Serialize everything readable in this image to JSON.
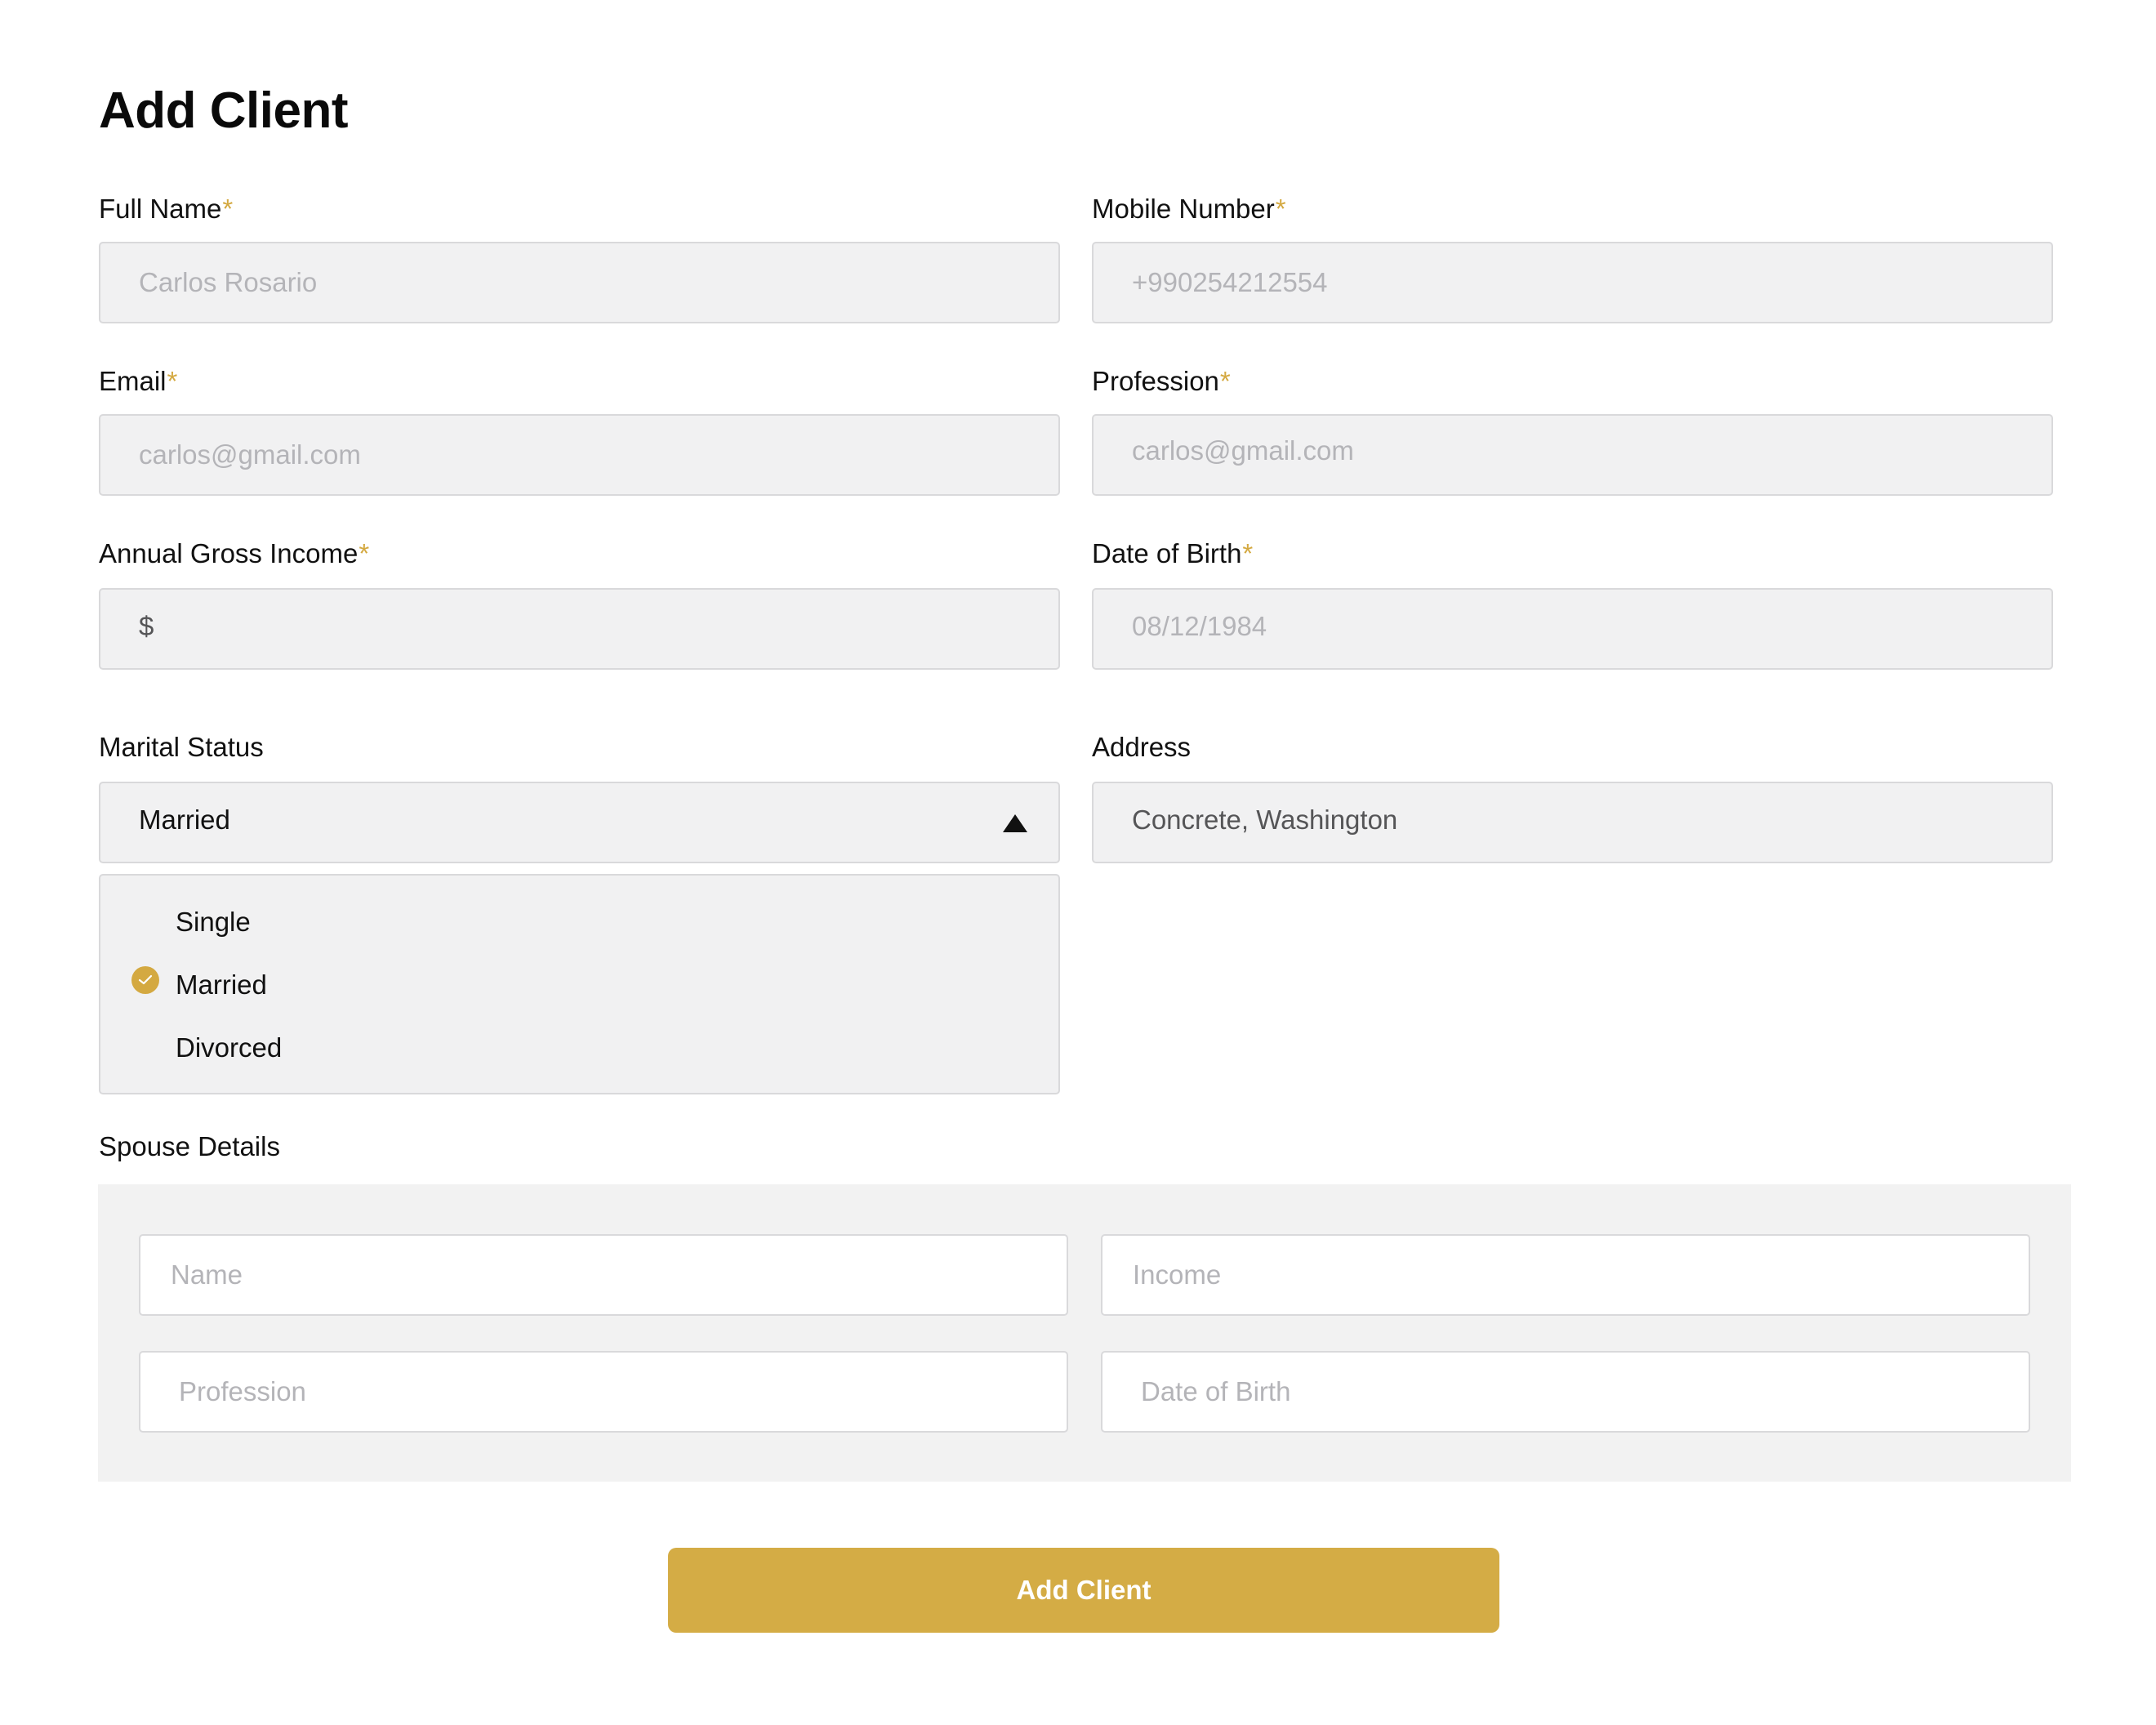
{
  "page": {
    "title": "Add Client"
  },
  "colors": {
    "accent": "#d4ac45",
    "required_marker": "#d4a941",
    "field_bg": "#f1f1f2",
    "panel_bg": "#f2f2f2"
  },
  "form": {
    "full_name": {
      "label": "Full Name",
      "required_mark": "*",
      "placeholder": "Carlos Rosario"
    },
    "mobile_number": {
      "label": "Mobile Number",
      "required_mark": "*",
      "placeholder": "+990254212554"
    },
    "email": {
      "label": "Email",
      "required_mark": "*",
      "placeholder": "carlos@gmail.com"
    },
    "profession": {
      "label": "Profession",
      "required_mark": "*",
      "placeholder": "carlos@gmail.com"
    },
    "annual_income": {
      "label": "Annual Gross Income",
      "required_mark": "*",
      "prefix": "$"
    },
    "date_of_birth": {
      "label": "Date of Birth",
      "required_mark": "*",
      "placeholder": "08/12/1984"
    },
    "marital_status": {
      "label": "Marital Status",
      "value": "Married",
      "options": [
        "Single",
        "Married",
        "Divorced"
      ],
      "selected_option": "Married",
      "expanded": true
    },
    "address": {
      "label": "Address",
      "value": "Concrete, Washington"
    }
  },
  "spouse": {
    "label": "Spouse Details",
    "name_placeholder": "Name",
    "income_placeholder": "Income",
    "profession_placeholder": "Profession",
    "dob_placeholder": "Date of Birth"
  },
  "submit": {
    "label": "Add Client"
  },
  "icons": {
    "select_arrow": "caret-up-icon",
    "selected_check": "check-circle-icon"
  }
}
